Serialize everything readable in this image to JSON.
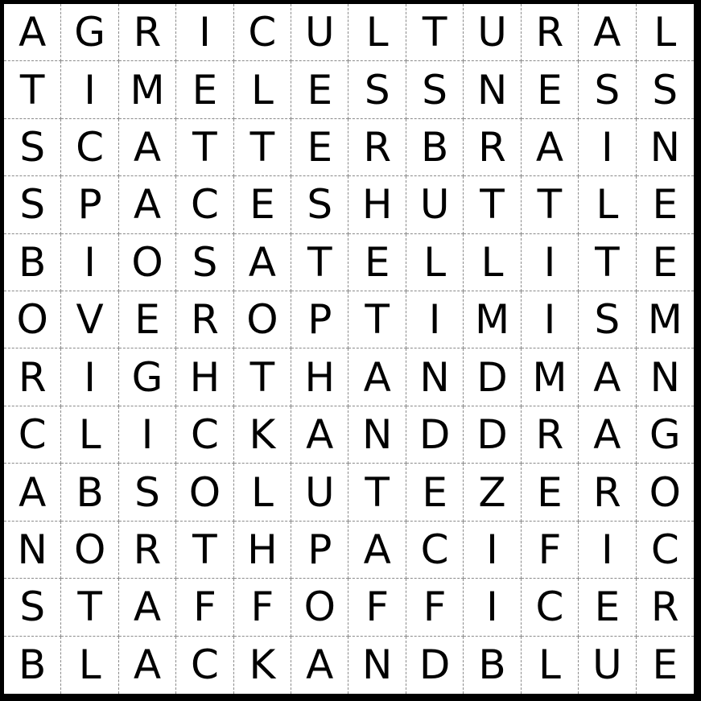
{
  "grid": {
    "rows": [
      [
        "A",
        "G",
        "R",
        "I",
        "C",
        "U",
        "L",
        "T",
        "U",
        "R",
        "A",
        "L"
      ],
      [
        "T",
        "I",
        "M",
        "E",
        "L",
        "E",
        "S",
        "S",
        "N",
        "E",
        "S",
        "S"
      ],
      [
        "S",
        "C",
        "A",
        "T",
        "T",
        "E",
        "R",
        "B",
        "R",
        "A",
        "I",
        "N"
      ],
      [
        "S",
        "P",
        "A",
        "C",
        "E",
        "S",
        "H",
        "U",
        "T",
        "T",
        "L",
        "E"
      ],
      [
        "B",
        "I",
        "O",
        "S",
        "A",
        "T",
        "E",
        "L",
        "L",
        "I",
        "T",
        "E"
      ],
      [
        "O",
        "V",
        "E",
        "R",
        "O",
        "P",
        "T",
        "I",
        "M",
        "I",
        "S",
        "M"
      ],
      [
        "R",
        "I",
        "G",
        "H",
        "T",
        "H",
        "A",
        "N",
        "D",
        "M",
        "A",
        "N"
      ],
      [
        "C",
        "L",
        "I",
        "C",
        "K",
        "A",
        "N",
        "D",
        "D",
        "R",
        "A",
        "G"
      ],
      [
        "A",
        "B",
        "S",
        "O",
        "L",
        "U",
        "T",
        "E",
        "Z",
        "E",
        "R",
        "O"
      ],
      [
        "N",
        "O",
        "R",
        "T",
        "H",
        "P",
        "A",
        "C",
        "I",
        "F",
        "I",
        "C"
      ],
      [
        "S",
        "T",
        "A",
        "F",
        "F",
        "O",
        "F",
        "F",
        "I",
        "C",
        "E",
        "R"
      ],
      [
        "B",
        "L",
        "A",
        "C",
        "K",
        "A",
        "N",
        "D",
        "B",
        "L",
        "U",
        "E"
      ]
    ]
  }
}
